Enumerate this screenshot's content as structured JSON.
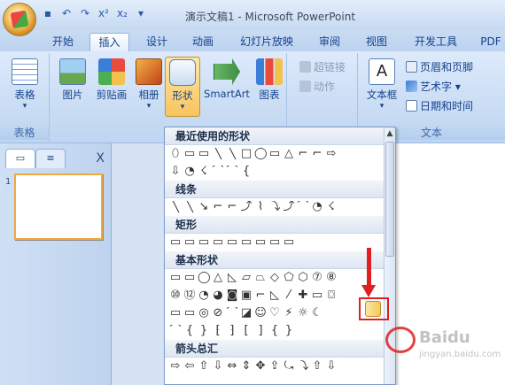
{
  "window": {
    "title": "演示文稿1 - Microsoft PowerPoint"
  },
  "quick_access": {
    "icons": [
      "save-icon",
      "undo-icon",
      "redo-icon",
      "superscript-icon",
      "subscript-icon",
      "qat-dropdown-icon"
    ]
  },
  "tabs": [
    "开始",
    "插入",
    "设计",
    "动画",
    "幻灯片放映",
    "审阅",
    "视图",
    "开发工具",
    "PDF"
  ],
  "active_tab": "插入",
  "ribbon": {
    "table_group": {
      "button": "表格",
      "label": "表格"
    },
    "illustrations": {
      "picture": "图片",
      "clipart": "剪贴画",
      "album": "相册",
      "shapes": "形状",
      "smartart": "SmartArt",
      "chart": "图表"
    },
    "links": {
      "hyperlink": "超链接",
      "action": "动作"
    },
    "text_group": {
      "textbox": "文本框",
      "header_footer": "页眉和页脚",
      "wordart": "艺术字",
      "datetime": "日期和时间",
      "label": "文本"
    }
  },
  "slides_pane": {
    "close": "X",
    "slide_number": "1"
  },
  "shapes_dropdown": {
    "sections": {
      "recent": "最近使用的形状",
      "lines": "线条",
      "rectangles": "矩形",
      "basic": "基本形状",
      "block_arrows": "箭头总汇"
    },
    "recent_row1": [
      "⬯",
      "▭",
      "▭",
      "╲",
      "╲",
      "□",
      "◯",
      "▭",
      "△",
      "⌐",
      "⌐",
      "⇨"
    ],
    "recent_row2": [
      "⇩",
      "◔",
      "☇",
      "⌒",
      "⌒",
      "{"
    ],
    "lines_row": [
      "╲",
      "╲",
      "↘",
      "⌐",
      "⌐",
      "⤴",
      "⌇",
      "⤵",
      "⤴",
      "⌒",
      "◔",
      "☇"
    ],
    "rect_row": [
      "▭",
      "▭",
      "▭",
      "▭",
      "▭",
      "▭",
      "▭",
      "▭",
      "▭"
    ],
    "basic_row1": [
      "▭",
      "▭",
      "◯",
      "△",
      "◺",
      "▱",
      "⏢",
      "◇",
      "⬠",
      "⬡",
      "⑦",
      "⑧"
    ],
    "basic_row2": [
      "⑩",
      "⑫",
      "◔",
      "◕",
      "◙",
      "▣",
      "⌐",
      "◺",
      "⁄",
      "✚",
      "▭",
      "⌼"
    ],
    "basic_row3": [
      "▭",
      "▭",
      "◎",
      "⊘",
      "⌒",
      "◪",
      "☺",
      "♡",
      "⚡",
      "☼",
      "☾",
      ""
    ],
    "basic_row4": [
      "⌒",
      "{",
      "}",
      "⁅",
      "⁆",
      "[",
      "]",
      "{",
      "}"
    ],
    "arrow_row": [
      "⇨",
      "⇦",
      "⇧",
      "⇩",
      "⇔",
      "⇕",
      "✥",
      "⇪",
      "⤿",
      "⤵",
      "⇧",
      "⇩"
    ]
  },
  "watermark": {
    "text": "Baidu",
    "sub": "jingyan.baidu.com"
  },
  "colors": {
    "accent": "#e02020",
    "ribbon": "#c7dbf3",
    "pressed": "#f8c45e"
  }
}
